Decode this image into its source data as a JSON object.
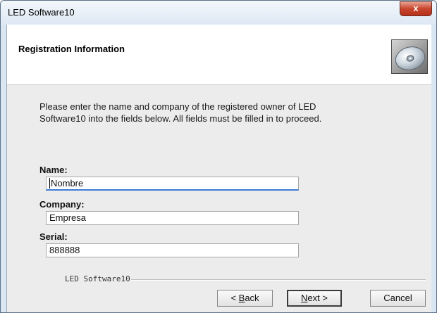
{
  "window": {
    "title": "LED Software10",
    "close_label": "x"
  },
  "header": {
    "title": "Registration Information",
    "icon": "cd-disc-icon"
  },
  "instructions": {
    "line1": "Please enter the name and company of the registered owner of LED",
    "line2": "Software10 into the fields below. All fields must be filled in to proceed."
  },
  "form": {
    "name_label": "Name:",
    "name_value": "Nombre",
    "company_label": "Company:",
    "company_value": "Empresa",
    "serial_label": "Serial:",
    "serial_value": "888888"
  },
  "footer": {
    "brand": "LED Software10"
  },
  "buttons": {
    "back_prefix": "< ",
    "back_mnemonic": "B",
    "back_rest": "ack",
    "next_mnemonic": "N",
    "next_rest": "ext >",
    "cancel": "Cancel"
  },
  "colors": {
    "client_bg": "#ececec",
    "close_red": "#c7442d",
    "focus_blue": "#3e7bd6"
  }
}
